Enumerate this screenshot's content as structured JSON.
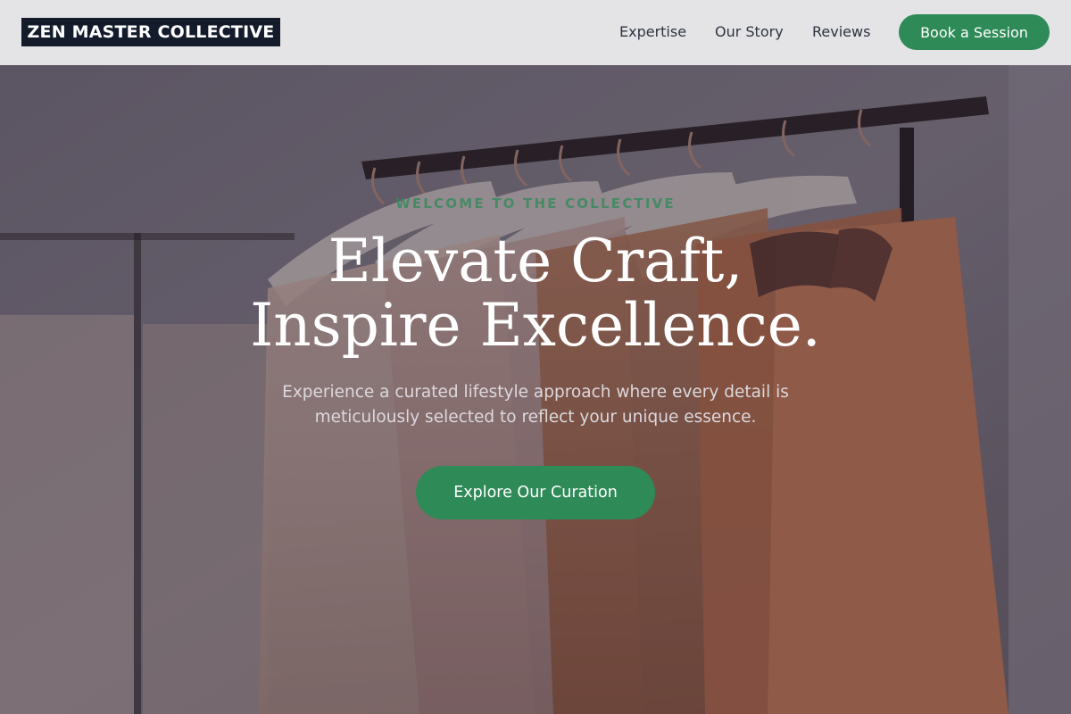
{
  "header": {
    "logo_text": "ZEN MASTER COLLECTIVE",
    "nav": [
      "Expertise",
      "Our Story",
      "Reviews"
    ],
    "cta_label": "Book a Session"
  },
  "hero": {
    "eyebrow": "WELCOME TO THE COLLECTIVE",
    "headline_line1": "Elevate Craft,",
    "headline_line2": "Inspire Excellence.",
    "subtext_line1": "Experience a curated lifestyle approach where every detail is",
    "subtext_line2": "meticulously selected to reflect your unique essence.",
    "cta_label": "Explore Our Curation"
  },
  "colors": {
    "accent": "#2e8a57",
    "header_bg": "#e4e4e6",
    "logo_bg": "#141c2c"
  }
}
